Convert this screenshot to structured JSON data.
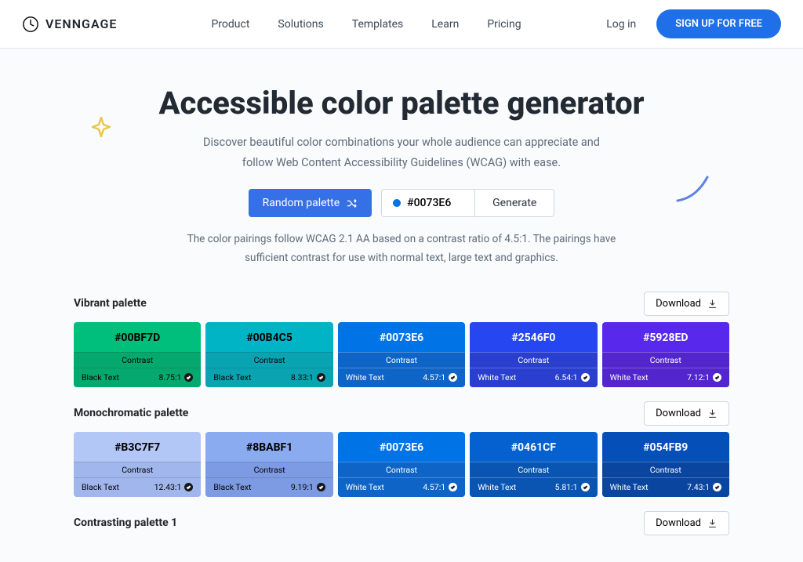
{
  "brand": "VENNGAGE",
  "nav": [
    "Product",
    "Solutions",
    "Templates",
    "Learn",
    "Pricing"
  ],
  "auth": {
    "login": "Log in",
    "signup": "SIGN UP FOR FREE"
  },
  "hero": {
    "title": "Accessible color palette generator",
    "sub1": "Discover beautiful color combinations your whole audience can appreciate and",
    "sub2": "follow Web Content Accessibility Guidelines (WCAG) with ease.",
    "random": "Random palette",
    "hex": "#0073E6",
    "generate": "Generate",
    "note1": "The color pairings follow WCAG 2.1 AA based on a contrast ratio of 4.5:1. The pairings have",
    "note2": "sufficient contrast for use with normal text, large text and graphics."
  },
  "download": "Download",
  "contrast_label": "Contrast",
  "palettes": [
    {
      "name": "Vibrant palette",
      "swatches": [
        {
          "hex": "#00BF7D",
          "dark": "#05a96f",
          "text": "Black Text",
          "ratio": "8.75:1",
          "light": false
        },
        {
          "hex": "#00B4C5",
          "dark": "#0aa3b2",
          "text": "Black Text",
          "ratio": "8.33:1",
          "light": false
        },
        {
          "hex": "#0073E6",
          "dark": "#0f64c7",
          "text": "White Text",
          "ratio": "4.57:1",
          "light": true
        },
        {
          "hex": "#2546F0",
          "dark": "#2a3ecf",
          "text": "White Text",
          "ratio": "6.54:1",
          "light": true
        },
        {
          "hex": "#5928ED",
          "dark": "#5226cc",
          "text": "White Text",
          "ratio": "7.12:1",
          "light": true
        }
      ]
    },
    {
      "name": "Monochromatic palette",
      "swatches": [
        {
          "hex": "#B3C7F7",
          "dark": "#a0b6ec",
          "text": "Black Text",
          "ratio": "12.43:1",
          "light": false
        },
        {
          "hex": "#8BABF1",
          "dark": "#7d9be2",
          "text": "Black Text",
          "ratio": "9.19:1",
          "light": false
        },
        {
          "hex": "#0073E6",
          "dark": "#0f64c7",
          "text": "White Text",
          "ratio": "4.57:1",
          "light": true
        },
        {
          "hex": "#0461CF",
          "dark": "#0b55b2",
          "text": "White Text",
          "ratio": "5.81:1",
          "light": true
        },
        {
          "hex": "#054FB9",
          "dark": "#0a459f",
          "text": "White Text",
          "ratio": "7.43:1",
          "light": true
        }
      ]
    }
  ],
  "extra_palette": "Contrasting palette 1"
}
